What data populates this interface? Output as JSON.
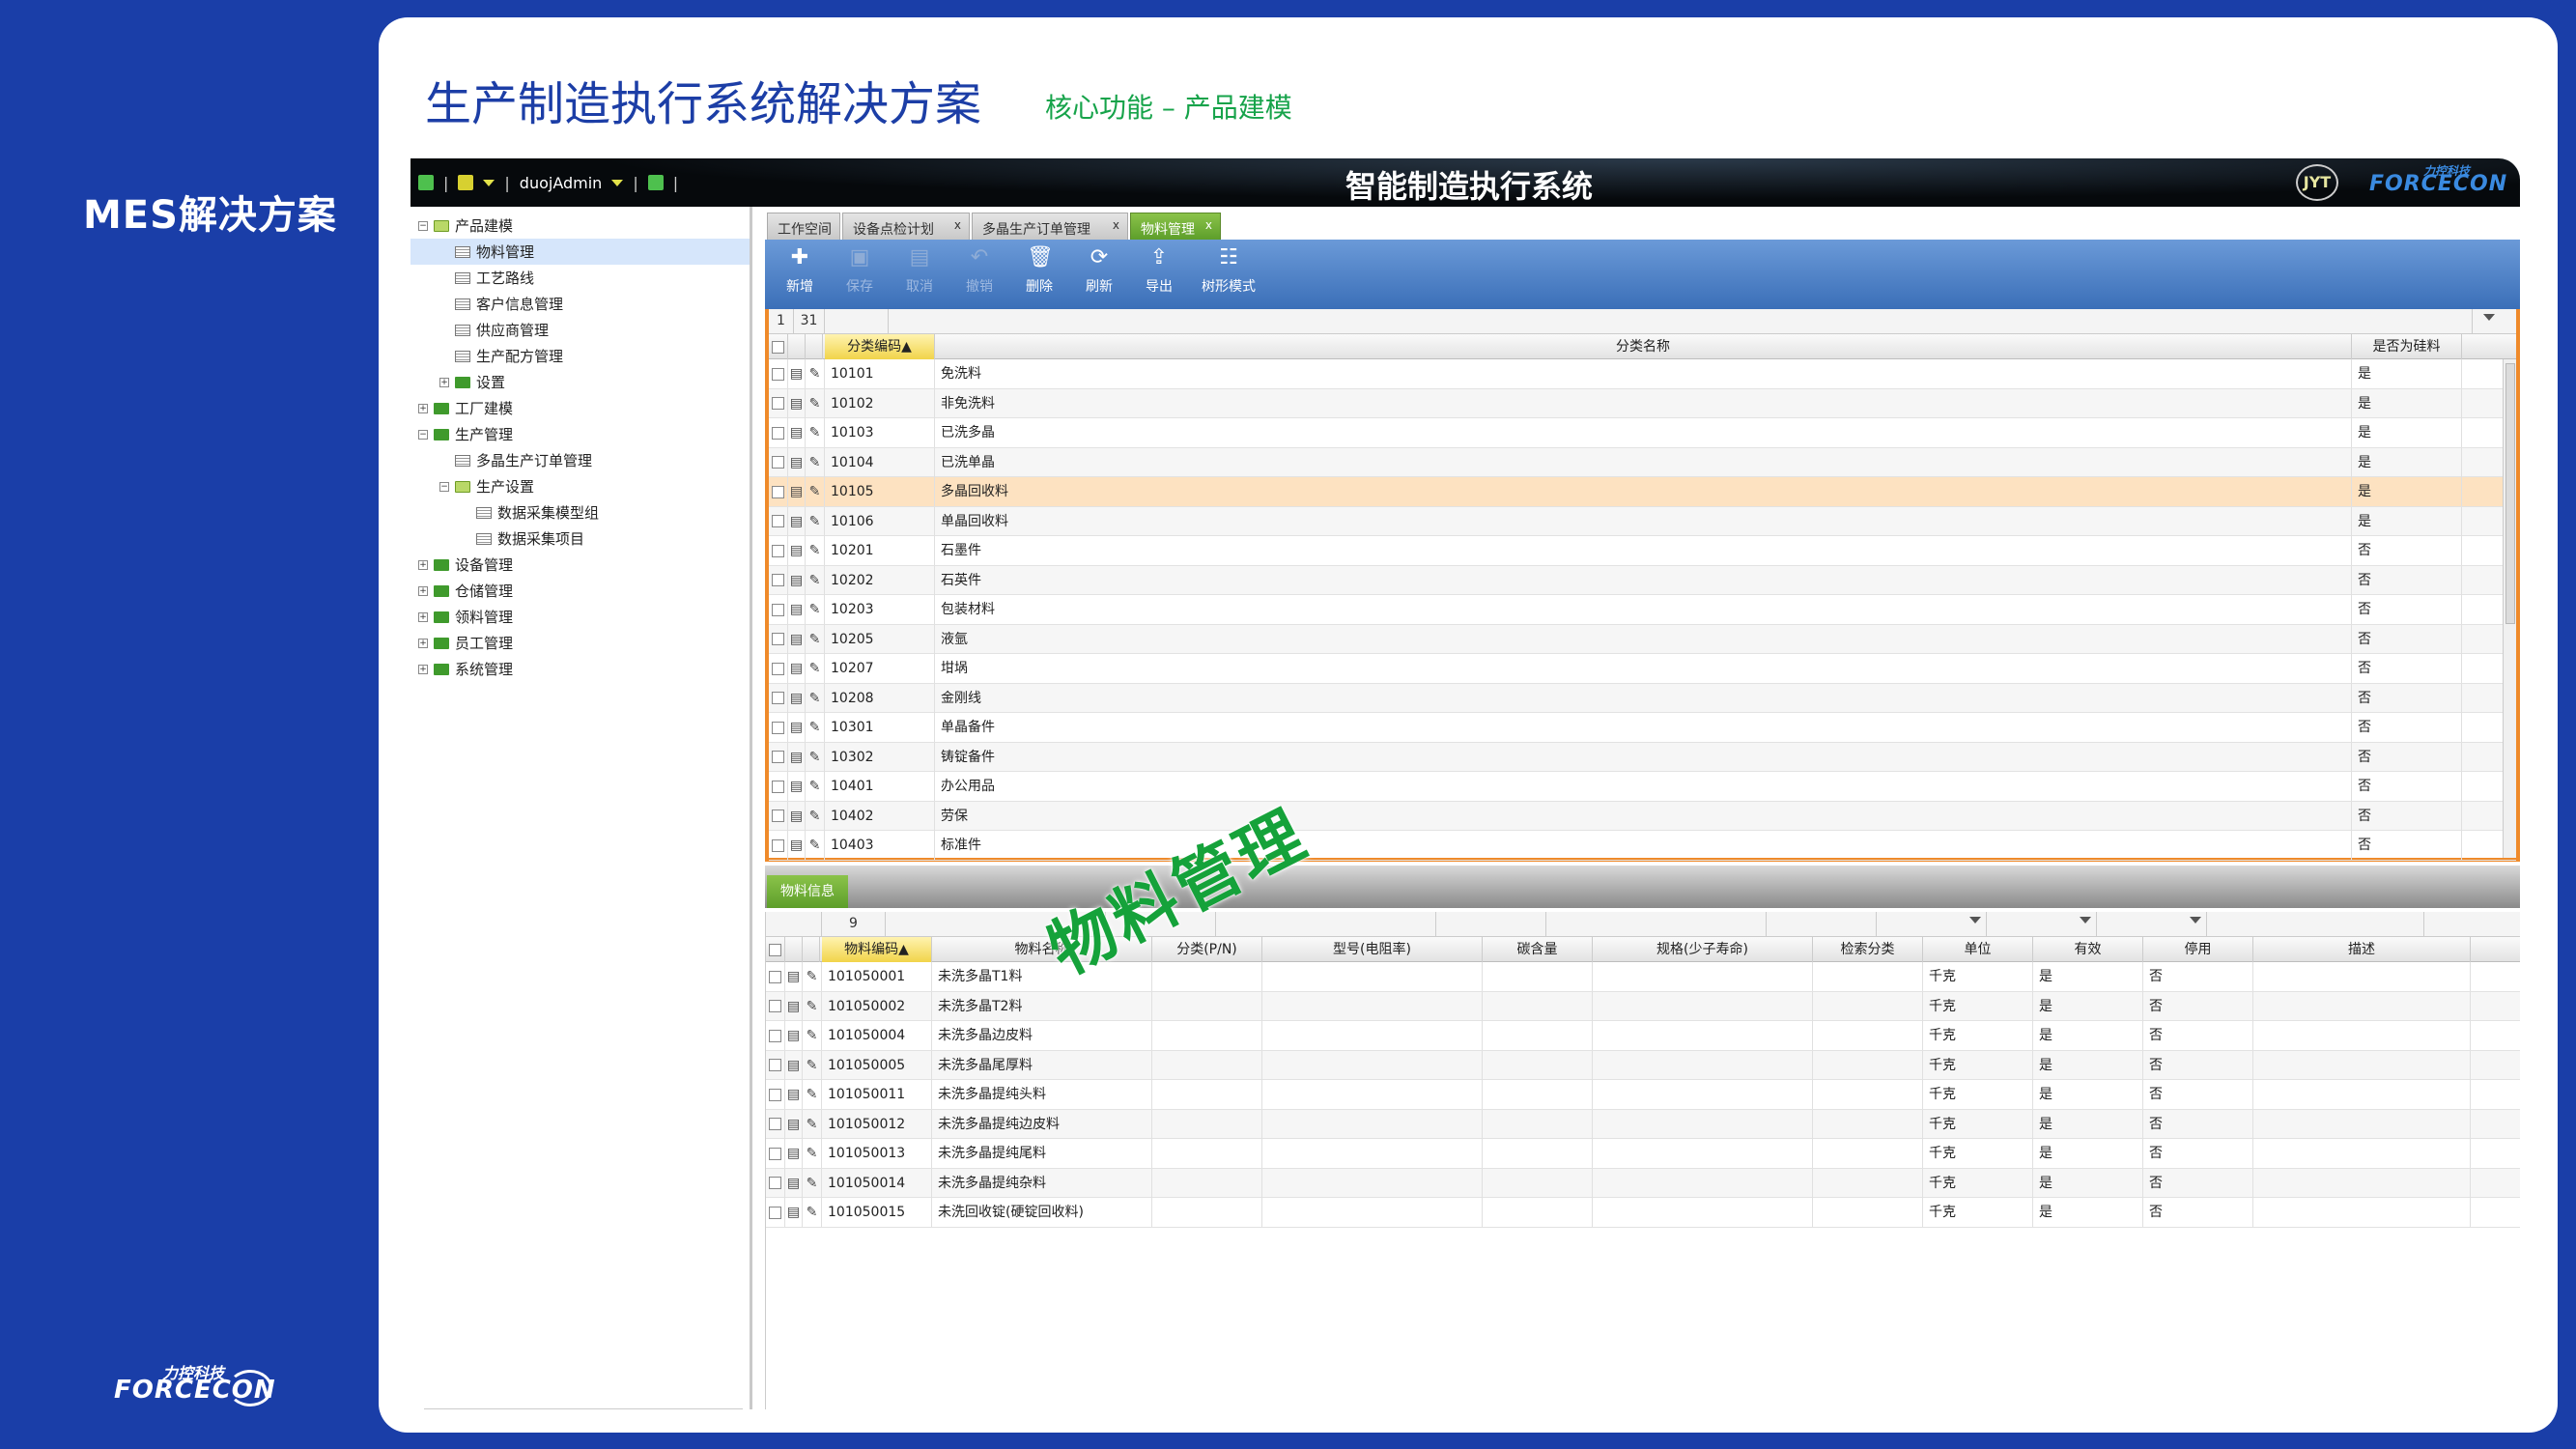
{
  "rail": {
    "title": "MES解决方案",
    "logo_cn": "力控科技",
    "logo_en": "FORCECON"
  },
  "slide": {
    "title": "生产制造执行系统解决方案",
    "subtitle": "核心功能 – 产品建模"
  },
  "app": {
    "user": "duojAdmin",
    "system_title": "智能制造执行系统",
    "logo_badge": "JYT",
    "logo_cn": "力控科技",
    "logo_en": "FORCECON"
  },
  "tree": [
    {
      "label": "产品建模",
      "level": 0,
      "toggle": "−",
      "type": "folder-open"
    },
    {
      "label": "物料管理",
      "level": 1,
      "type": "page",
      "selected": true
    },
    {
      "label": "工艺路线",
      "level": 1,
      "type": "page"
    },
    {
      "label": "客户信息管理",
      "level": 1,
      "type": "page"
    },
    {
      "label": "供应商管理",
      "level": 1,
      "type": "page"
    },
    {
      "label": "生产配方管理",
      "level": 1,
      "type": "page"
    },
    {
      "label": "设置",
      "level": 1,
      "toggle": "+",
      "type": "folder"
    },
    {
      "label": "工厂建模",
      "level": 0,
      "toggle": "+",
      "type": "folder"
    },
    {
      "label": "生产管理",
      "level": 0,
      "toggle": "−",
      "type": "folder"
    },
    {
      "label": "多晶生产订单管理",
      "level": 1,
      "type": "page"
    },
    {
      "label": "生产设置",
      "level": 1,
      "toggle": "−",
      "type": "folder-open"
    },
    {
      "label": "数据采集模型组",
      "level": 2,
      "type": "page"
    },
    {
      "label": "数据采集项目",
      "level": 2,
      "type": "page"
    },
    {
      "label": "设备管理",
      "level": 0,
      "toggle": "+",
      "type": "folder"
    },
    {
      "label": "仓储管理",
      "level": 0,
      "toggle": "+",
      "type": "folder"
    },
    {
      "label": "领料管理",
      "level": 0,
      "toggle": "+",
      "type": "folder"
    },
    {
      "label": "员工管理",
      "level": 0,
      "toggle": "+",
      "type": "folder"
    },
    {
      "label": "系统管理",
      "level": 0,
      "toggle": "+",
      "type": "folder"
    }
  ],
  "tabs": [
    {
      "label": "工作空间",
      "closable": false
    },
    {
      "label": "设备点检计划",
      "closable": true
    },
    {
      "label": "多晶生产订单管理",
      "closable": true
    },
    {
      "label": "物料管理",
      "closable": true,
      "active": true
    }
  ],
  "toolbar": [
    {
      "label": "新增",
      "glyph": "✚",
      "enabled": true,
      "icon": "new-icon"
    },
    {
      "label": "保存",
      "glyph": "▣",
      "enabled": false,
      "icon": "save-icon"
    },
    {
      "label": "取消",
      "glyph": "▤",
      "enabled": false,
      "icon": "cancel-icon"
    },
    {
      "label": "撤销",
      "glyph": "↶",
      "enabled": false,
      "icon": "undo-icon"
    },
    {
      "label": "删除",
      "glyph": "🗑",
      "enabled": true,
      "icon": "delete-icon"
    },
    {
      "label": "刷新",
      "glyph": "⟳",
      "enabled": true,
      "icon": "refresh-icon"
    },
    {
      "label": "导出",
      "glyph": "⇪",
      "enabled": true,
      "icon": "export-icon"
    },
    {
      "label": "树形模式",
      "glyph": "☷",
      "enabled": true,
      "icon": "tree-mode-icon"
    }
  ],
  "upper_grid": {
    "pager_page": "1",
    "pager_total": "31",
    "columns": [
      "分类编码",
      "分类名称",
      "是否为硅料"
    ],
    "sorted_indicator": "▲",
    "rows": [
      [
        "10101",
        "免洗料",
        "是"
      ],
      [
        "10102",
        "非免洗料",
        "是"
      ],
      [
        "10103",
        "已洗多晶",
        "是"
      ],
      [
        "10104",
        "已洗单晶",
        "是"
      ],
      [
        "10105",
        "多晶回收料",
        "是"
      ],
      [
        "10106",
        "单晶回收料",
        "是"
      ],
      [
        "10201",
        "石墨件",
        "否"
      ],
      [
        "10202",
        "石英件",
        "否"
      ],
      [
        "10203",
        "包装材料",
        "否"
      ],
      [
        "10205",
        "液氩",
        "否"
      ],
      [
        "10207",
        "坩埚",
        "否"
      ],
      [
        "10208",
        "金刚线",
        "否"
      ],
      [
        "10301",
        "单晶备件",
        "否"
      ],
      [
        "10302",
        "铸锭备件",
        "否"
      ],
      [
        "10401",
        "办公用品",
        "否"
      ],
      [
        "10402",
        "劳保",
        "否"
      ],
      [
        "10403",
        "标准件",
        "否"
      ]
    ],
    "highlight_index": 4
  },
  "lower_tab": "物料信息",
  "lower_grid": {
    "pager_total": "9",
    "columns": [
      "物料编码",
      "物料名称",
      "分类(P/N)",
      "型号(电阻率)",
      "碳含量",
      "规格(少子寿命)",
      "检索分类",
      "单位",
      "有效",
      "停用",
      "描述"
    ],
    "sorted_indicator": "▲",
    "rows": [
      [
        "101050001",
        "未洗多晶T1料",
        "",
        "",
        "",
        "",
        "",
        "千克",
        "是",
        "否",
        ""
      ],
      [
        "101050002",
        "未洗多晶T2料",
        "",
        "",
        "",
        "",
        "",
        "千克",
        "是",
        "否",
        ""
      ],
      [
        "101050004",
        "未洗多晶边皮料",
        "",
        "",
        "",
        "",
        "",
        "千克",
        "是",
        "否",
        ""
      ],
      [
        "101050005",
        "未洗多晶尾厚料",
        "",
        "",
        "",
        "",
        "",
        "千克",
        "是",
        "否",
        ""
      ],
      [
        "101050011",
        "未洗多晶提纯头料",
        "",
        "",
        "",
        "",
        "",
        "千克",
        "是",
        "否",
        ""
      ],
      [
        "101050012",
        "未洗多晶提纯边皮料",
        "",
        "",
        "",
        "",
        "",
        "千克",
        "是",
        "否",
        ""
      ],
      [
        "101050013",
        "未洗多晶提纯尾料",
        "",
        "",
        "",
        "",
        "",
        "千克",
        "是",
        "否",
        ""
      ],
      [
        "101050014",
        "未洗多晶提纯杂料",
        "",
        "",
        "",
        "",
        "",
        "千克",
        "是",
        "否",
        ""
      ],
      [
        "101050015",
        "未洗回收锭(硬锭回收料)",
        "",
        "",
        "",
        "",
        "",
        "千克",
        "是",
        "否",
        ""
      ]
    ]
  },
  "watermark": "物料管理"
}
